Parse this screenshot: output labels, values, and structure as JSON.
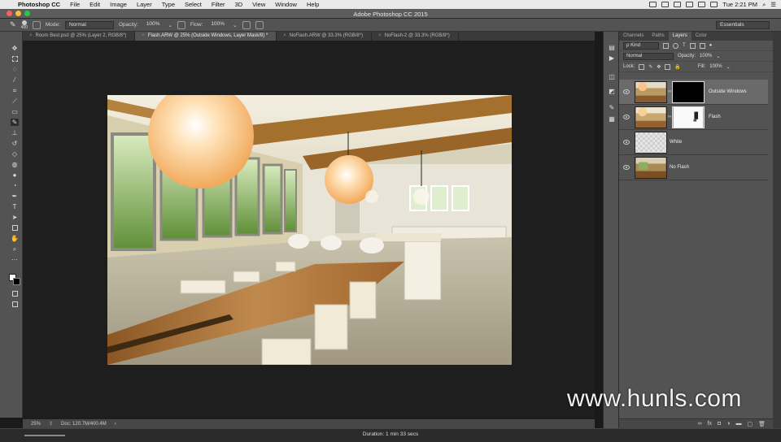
{
  "menubar": {
    "items": [
      "Photoshop CC",
      "File",
      "Edit",
      "Image",
      "Layer",
      "Type",
      "Select",
      "Filter",
      "3D",
      "View",
      "Window",
      "Help"
    ],
    "time": "Tue 2:21 PM"
  },
  "window": {
    "title": "Adobe Photoshop CC 2015",
    "dot_colors": [
      "#ff5f57",
      "#ffbd2e",
      "#28c940"
    ]
  },
  "options": {
    "brush_size": "400",
    "mode_label": "Mode:",
    "mode_value": "Normal",
    "opacity_label": "Opacity:",
    "opacity_value": "100%",
    "flow_label": "Flow:",
    "flow_value": "100%",
    "workspace": "Essentials"
  },
  "doc_tabs": [
    "Room Best.psd @ 25% (Layer 2, RGB/8*)",
    "Flash.ARW @ 25% (Outside Windows, Layer Mask/8) *",
    "NoFlash.ARW @ 33.3% (RGB/8*)",
    "NoFlash-2 @ 33.3% (RGB/8*)"
  ],
  "status": {
    "zoom": "25%",
    "doc": "Doc: 120.7M/400.4M"
  },
  "duration": "Duration: 1 min 33 secs",
  "panel": {
    "tabs": [
      "Channels",
      "Paths",
      "Layers",
      "Color"
    ],
    "kind_label": "ρ Kind",
    "blend_mode": "Normal",
    "opacity_label": "Opacity:",
    "opacity_value": "100%",
    "lock_label": "Lock:",
    "fill_label": "Fill:",
    "fill_value": "100%"
  },
  "layers": [
    {
      "name": "Outside Windows",
      "selected": true,
      "mask": "black"
    },
    {
      "name": "Flash",
      "selected": false,
      "mask": "white"
    },
    {
      "name": "White",
      "selected": false,
      "mask": null
    },
    {
      "name": "No Flash",
      "selected": false,
      "mask": null
    }
  ],
  "watermark": "www.hunls.com",
  "icons": {
    "tools": [
      "move-tool-icon",
      "marquee-tool-icon",
      "lasso-tool-icon",
      "magic-wand-icon",
      "crop-tool-icon",
      "eyedropper-icon",
      "healing-brush-icon",
      "brush-tool-icon",
      "stamp-tool-icon",
      "history-brush-icon",
      "eraser-icon",
      "paint-bucket-icon",
      "blur-tool-icon",
      "dodge-tool-icon",
      "pen-tool-icon",
      "type-tool-icon",
      "path-select-icon",
      "shape-tool-icon",
      "hand-tool-icon",
      "zoom-tool-icon",
      "more-tools-icon"
    ]
  }
}
